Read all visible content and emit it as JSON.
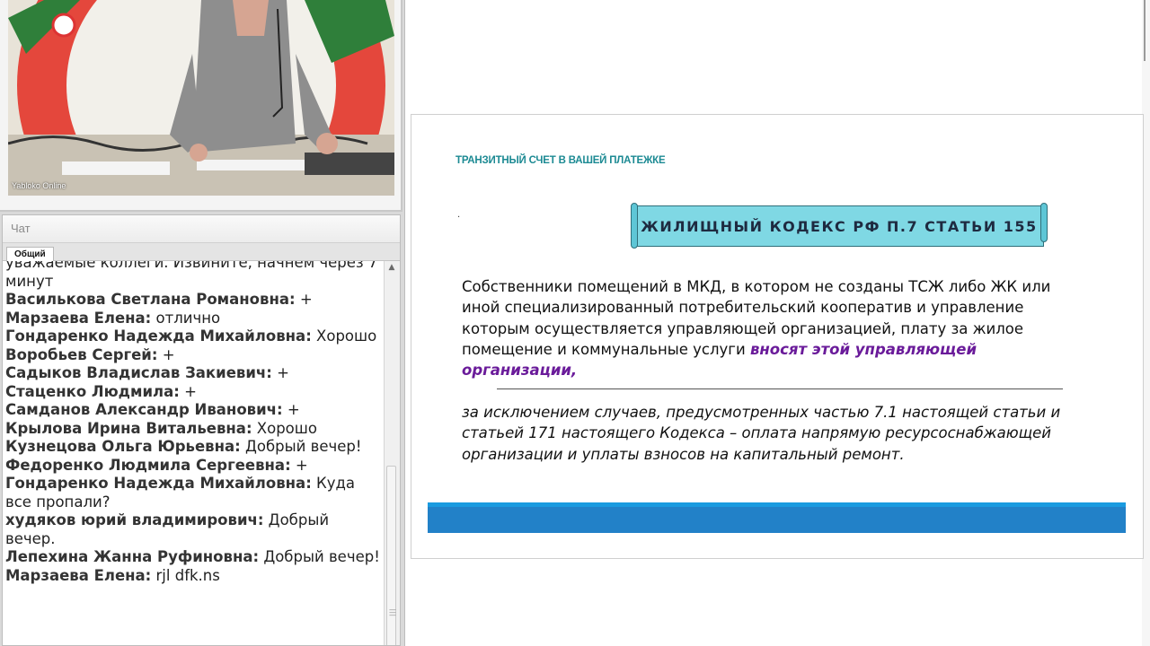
{
  "video": {
    "label": "Yabloko Online"
  },
  "chat": {
    "title": "Чат",
    "tab": "Общий",
    "messages": [
      {
        "author": "",
        "text": "уважаемые коллеги. Извините, начнем через 7 минут"
      },
      {
        "author": "Василькова Светлана Романовна:",
        "text": " +"
      },
      {
        "author": "Марзаева Елена:",
        "text": " отлично"
      },
      {
        "author": "Гондаренко Надежда Михайловна:",
        "text": " Хорошо"
      },
      {
        "author": "Воробьев Сергей:",
        "text": " +"
      },
      {
        "author": "Садыков Владислав Закиевич:",
        "text": " +"
      },
      {
        "author": "Стаценко Людмила:",
        "text": " +"
      },
      {
        "author": "Самданов Александр Иванович:",
        "text": " +"
      },
      {
        "author": "Крылова Ирина Витальевна:",
        "text": "  Хорошо"
      },
      {
        "author": "Кузнецова Ольга Юрьевна:",
        "text": " Добрый вечер!"
      },
      {
        "author": "Федоренко Людмила Сергеевна:",
        "text": " +"
      },
      {
        "author": "Гондаренко Надежда Михайловна:",
        "text": " Куда все пропали?"
      },
      {
        "author": "худяков юрий владимирович:",
        "text": " Добрый вечер."
      },
      {
        "author": "Лепехина Жанна Руфиновна:",
        "text": " Добрый вечер!"
      },
      {
        "author": "Марзаева Елена:",
        "text": " rjl dfk.ns"
      }
    ]
  },
  "slide": {
    "title": "ТРАНЗИТНЫЙ СЧЕТ В ВАШЕЙ ПЛАТЕЖКЕ",
    "dot": ".",
    "banner": "ЖИЛИЩНЫЙ КОДЕКС РФ П.7 СТАТЬИ 155",
    "para1": "Собственники помещений в МКД, в котором не созданы ТСЖ либо ЖК или иной специализированный потребительский кооператив и управление которым осуществляется управляющей организацией, плату за жилое помещение и коммунальные услуги ",
    "para1_highlight": "вносят этой управляющей организации,",
    "para2": "за исключением случаев, предусмотренных частью 7.1 настоящей статьи и статьей 171 настоящего Кодекса – оплата напрямую ресурсоснабжающей организации и уплаты взносов на капитальный ремонт."
  },
  "colors": {
    "title": "#1c8a93",
    "banner": "#7fd8e4",
    "highlight": "#6a1b9a",
    "footer": "#2281c8"
  }
}
